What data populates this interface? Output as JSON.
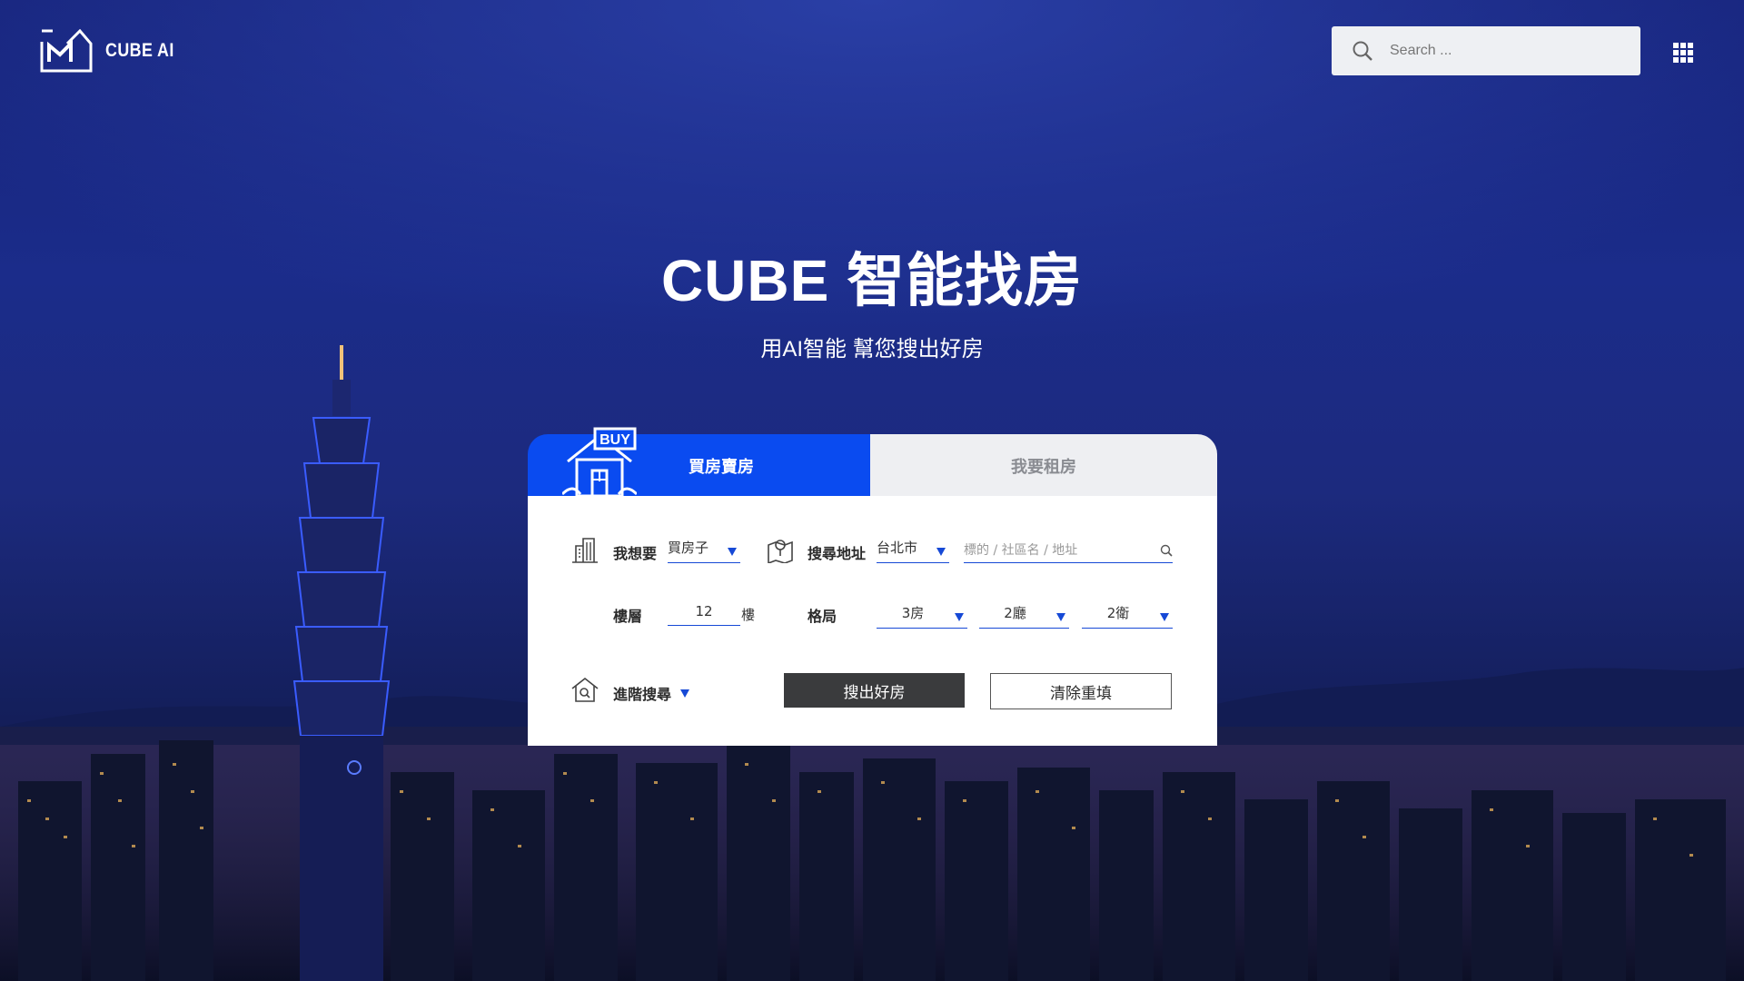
{
  "brand": {
    "name": "CUBE AI"
  },
  "header": {
    "search_placeholder": "Search ..."
  },
  "hero": {
    "title": "CUBE 智能找房",
    "subtitle": "用AI智能 幫您搜出好房"
  },
  "tabs": {
    "buy_badge": "BUY",
    "buy": "買房賣房",
    "rent": "我要租房"
  },
  "form": {
    "want_label": "我想要",
    "want_value": "買房子",
    "address_label": "搜尋地址",
    "city_value": "台北市",
    "address_placeholder": "標的 / 社區名 / 地址",
    "floor_label": "樓層",
    "floor_value": "12",
    "floor_unit": "樓",
    "layout_label": "格局",
    "rooms_value": "3房",
    "halls_value": "2廳",
    "baths_value": "2衛",
    "advanced_label": "進階搜尋",
    "search_button": "搜出好房",
    "clear_button": "清除重填"
  },
  "colors": {
    "accent": "#0a4bf0",
    "underline": "#1649d6",
    "dark_button": "#3a3b3d"
  }
}
